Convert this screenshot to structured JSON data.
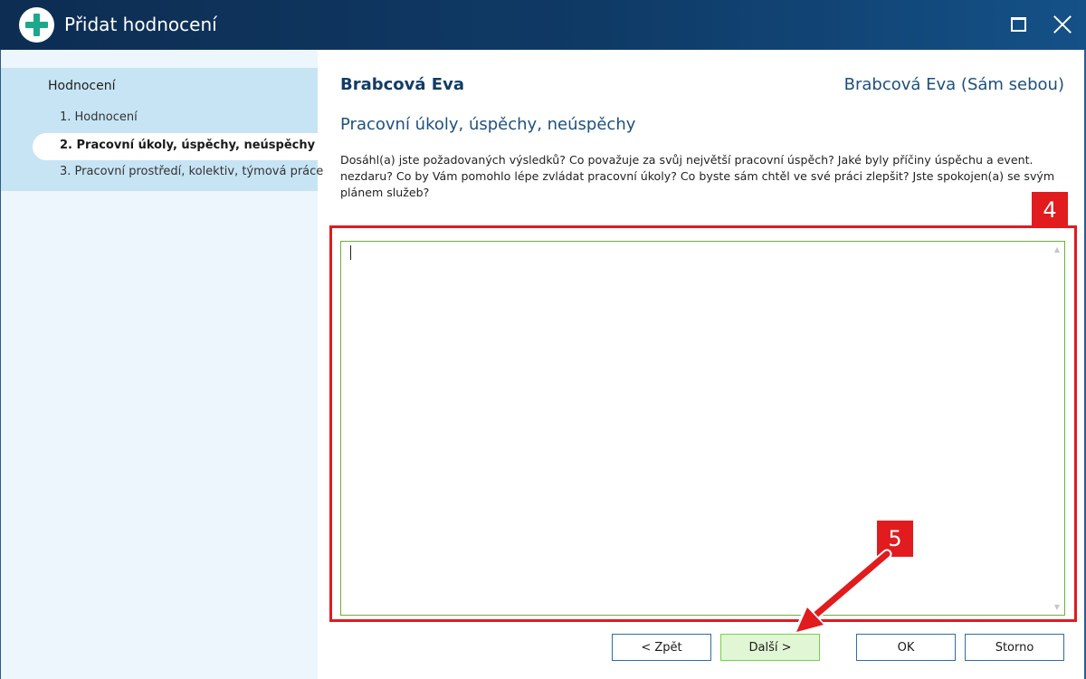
{
  "window": {
    "title": "Přidat hodnocení"
  },
  "sidebar": {
    "header": "Hodnocení",
    "items": [
      {
        "label": "1. Hodnocení"
      },
      {
        "label": "2. Pracovní úkoly, úspěchy, neúspěchy"
      },
      {
        "label": "3. Pracovní prostředí, kolektiv, týmová práce"
      }
    ],
    "active_index": 1
  },
  "content": {
    "person_name": "Brabcová Eva",
    "evaluator": "Brabcová Eva (Sám sebou)",
    "section_title": "Pracovní úkoly, úspěchy, neúspěchy",
    "question": "Dosáhl(a) jste požadovaných výsledků? Co považuje za svůj největší pracovní úspěch? Jaké byly příčiny úspěchu a event. nezdaru? Co by Vám pomohlo lépe zvládat pracovní úkoly? Co byste sám chtěl ve své práci zlepšit? Jste spokojen(a) se svým plánem služeb?",
    "answer_value": ""
  },
  "annotations": {
    "badge_4": "4",
    "badge_5": "5",
    "color": "#e11b1e"
  },
  "buttons": {
    "back": "< Zpět",
    "next": "Další >",
    "ok": "OK",
    "cancel": "Storno"
  },
  "colors": {
    "titlebar": "#0f3a66",
    "sidebar_bg": "#ecf6fc",
    "sidebar_nav": "#c7e4f4",
    "accent_green": "#1ca88c",
    "next_button_bg": "#e0f6d4"
  }
}
